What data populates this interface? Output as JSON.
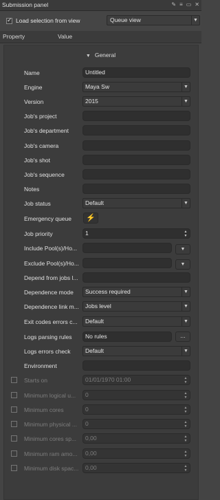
{
  "window": {
    "title": "Submission panel"
  },
  "toolbar": {
    "load_selection_label": "Load selection from view",
    "load_selection_checked": true,
    "view_select": "Queue view"
  },
  "columns": {
    "property": "Property",
    "value": "Value"
  },
  "section": {
    "title": "General"
  },
  "fields": {
    "name": {
      "label": "Name",
      "value": "Untitled"
    },
    "engine": {
      "label": "Engine",
      "value": "Maya Sw"
    },
    "version": {
      "label": "Version",
      "value": "2015"
    },
    "jobs_project": {
      "label": "Job's project",
      "value": ""
    },
    "jobs_department": {
      "label": "Job's department",
      "value": ""
    },
    "jobs_camera": {
      "label": "Job's camera",
      "value": ""
    },
    "jobs_shot": {
      "label": "Job's shot",
      "value": ""
    },
    "jobs_sequence": {
      "label": "Job's sequence",
      "value": ""
    },
    "notes": {
      "label": "Notes",
      "value": ""
    },
    "job_status": {
      "label": "Job status",
      "value": "Default"
    },
    "emergency_queue": {
      "label": "Emergency queue"
    },
    "job_priority": {
      "label": "Job priority",
      "value": "1"
    },
    "include_pools": {
      "label": "Include Pool(s)/Ho...",
      "value": ""
    },
    "exclude_pools": {
      "label": "Exclude Pool(s)/Ho...",
      "value": ""
    },
    "depend_from_jobs": {
      "label": "Depend from jobs l...",
      "value": ""
    },
    "dependence_mode": {
      "label": "Dependence mode",
      "value": "Success required"
    },
    "dependence_link": {
      "label": "Dependence link m...",
      "value": "Jobs level"
    },
    "exit_codes": {
      "label": "Exit codes errors c...",
      "value": "Default"
    },
    "logs_parsing": {
      "label": "Logs parsing rules",
      "value": "No rules",
      "button": "..."
    },
    "logs_errors": {
      "label": "Logs errors check",
      "value": "Default"
    },
    "environment": {
      "label": "Environment",
      "value": ""
    },
    "starts_on": {
      "label": "Starts on",
      "value": "01/01/1970 01:00"
    },
    "min_logical": {
      "label": "Minimum logical u...",
      "value": "0"
    },
    "min_cores": {
      "label": "Minimum cores",
      "value": "0"
    },
    "min_physical": {
      "label": "Minimum physical ...",
      "value": "0"
    },
    "min_cores_speed": {
      "label": "Minimum cores sp...",
      "value": "0,00"
    },
    "min_ram": {
      "label": "Minimum ram amo...",
      "value": "0,00"
    },
    "min_disk": {
      "label": "Minimum disk spac...",
      "value": "0,00"
    }
  },
  "icons": {
    "pin": "pin-icon",
    "menu": "menu-icon",
    "window": "window-icon",
    "close": "close-icon",
    "emergency": "lightning-icon"
  },
  "colors": {
    "emergency_icon": "#f2c12e"
  }
}
